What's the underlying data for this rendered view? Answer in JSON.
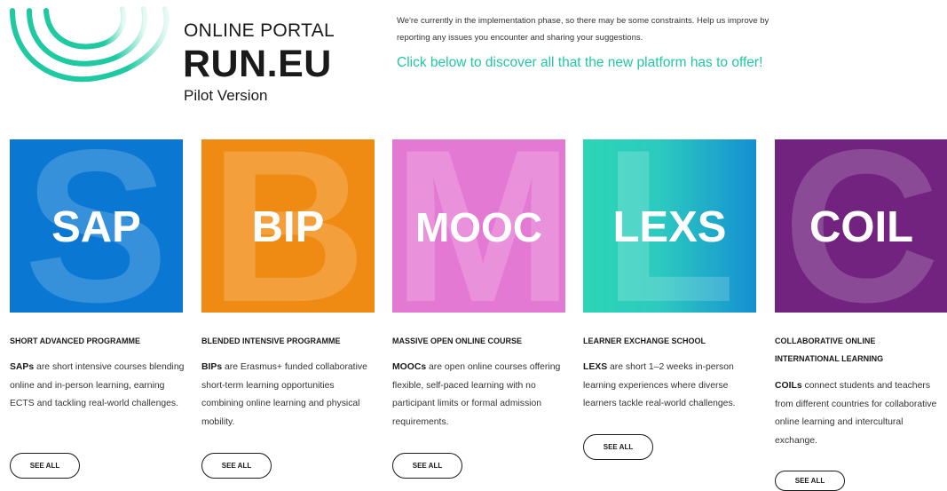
{
  "header": {
    "title": "ONLINE PORTAL",
    "name": "RUN.EU",
    "version": "Pilot Version",
    "notice": "We're currently in the implementation phase, so there may be some constraints. Help us improve by reporting any issues you encounter and sharing your suggestions.",
    "cta": "Click below to discover all that the new platform has to offer!"
  },
  "colors": {
    "accent": "#22c7a4",
    "sap": "#0a78d2",
    "bip": "#ef8a12",
    "mooc": "#e479d4",
    "lexs": "#2cd2b8",
    "coil": "#72237f"
  },
  "cards": [
    {
      "acronym": "SAP",
      "letter": "S",
      "title": "SHORT ADVANCED PROGRAMME",
      "lead": "SAPs",
      "desc": " are short intensive courses blending online and in-person learning, earning ECTS and tackling real-world challenges.",
      "button": "SEE ALL"
    },
    {
      "acronym": "BIP",
      "letter": "B",
      "title": "BLENDED INTENSIVE PROGRAMME",
      "lead": "BIPs",
      "desc": " are Erasmus+ funded collaborative short-term learning opportunities combining online learning and physical mobility.",
      "button": "SEE ALL"
    },
    {
      "acronym": "MOOC",
      "letter": "M",
      "title": "MASSIVE OPEN ONLINE COURSE",
      "lead": "MOOCs",
      "desc": " are open online courses offering flexible, self-paced learning with no participant limits or formal admission requirements.",
      "button": "SEE ALL"
    },
    {
      "acronym": "LEXS",
      "letter": "L",
      "title": "LEARNER EXCHANGE SCHOOL",
      "lead": "LEXS",
      "desc": " are short 1–2 weeks in-person learning experiences where diverse learners tackle real-world challenges.",
      "button": "SEE ALL"
    },
    {
      "acronym": "COIL",
      "letter": "C",
      "title": "COLLABORATIVE ONLINE INTERNATIONAL LEARNING",
      "lead": "COILs",
      "desc": " connect students and teachers from different countries for collaborative online learning and intercultural exchange.",
      "button": "SEE ALL"
    }
  ]
}
